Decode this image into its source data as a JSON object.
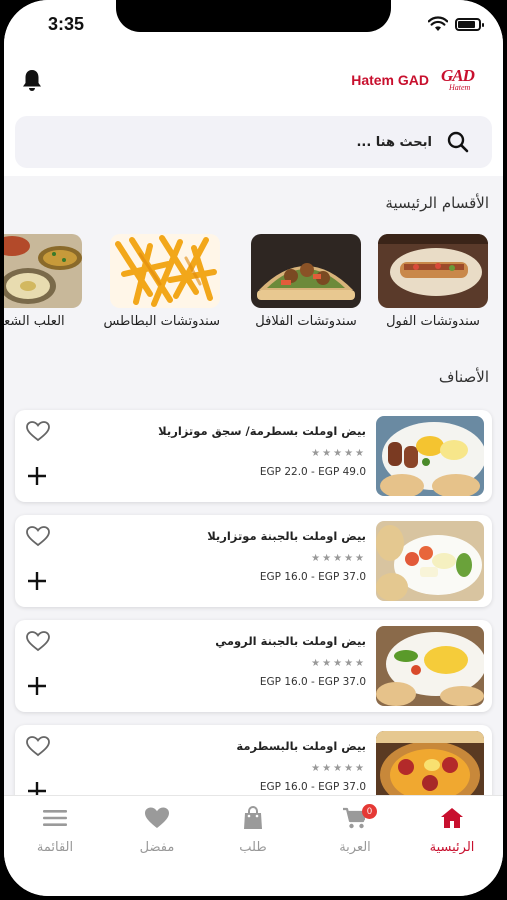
{
  "status_bar": {
    "time": "3:35",
    "battery_level": 0.85
  },
  "header": {
    "brand_name": "Hatem GAD",
    "logo_text": "GAD",
    "logo_sub": "Hatem"
  },
  "search": {
    "placeholder": "ابحث هنا ..."
  },
  "sections": {
    "main_categories": "الأقسام الرئيسية",
    "items": "الأصناف"
  },
  "categories": [
    {
      "label": "سندوتشات الفول"
    },
    {
      "label": "سندوتشات الفلافل"
    },
    {
      "label": "سندوتشات البطاطس"
    },
    {
      "label": "العلب الشعبية"
    }
  ],
  "items": [
    {
      "name": "بيض اوملت بسطرمة/ سجق موتزاريلا",
      "stars": "★★★★★",
      "price": "EGP 22.0 - EGP 49.0"
    },
    {
      "name": "بيض اوملت بالجبنة موتزاريلا",
      "stars": "★★★★★",
      "price": "EGP 16.0 - EGP 37.0"
    },
    {
      "name": "بيض اوملت بالجبنة الرومي",
      "stars": "★★★★★",
      "price": "EGP 16.0 - EGP 37.0"
    },
    {
      "name": "بيض اوملت بالبسطرمة",
      "stars": "★★★★★",
      "price": "EGP 16.0 - EGP 37.0"
    }
  ],
  "tabbar": {
    "home": "الرئيسية",
    "cart": "العربة",
    "cart_badge": "0",
    "orders": "طلب",
    "favorites": "مفضل",
    "menu": "القائمة"
  },
  "colors": {
    "brand": "#c8102e",
    "inactive": "#999999",
    "badge": "#e53935"
  }
}
